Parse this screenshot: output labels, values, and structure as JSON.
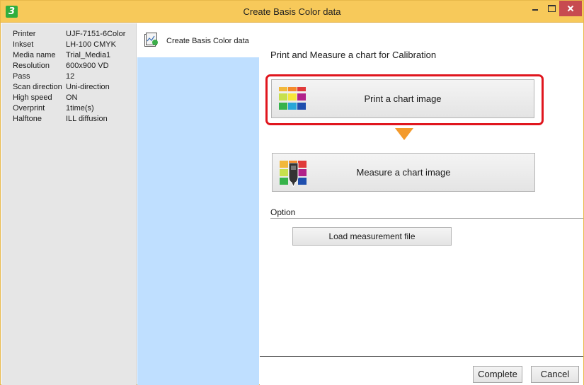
{
  "window": {
    "title": "Create Basis Color data"
  },
  "info": [
    {
      "label": "Printer",
      "value": "UJF-7151-6Color"
    },
    {
      "label": "Inkset",
      "value": "LH-100 CMYK"
    },
    {
      "label": "Media name",
      "value": "Trial_Media1"
    },
    {
      "label": "Resolution",
      "value": "600x900 VD"
    },
    {
      "label": "Pass",
      "value": "12"
    },
    {
      "label": "Scan direction",
      "value": "Uni-direction"
    },
    {
      "label": "High speed",
      "value": "ON"
    },
    {
      "label": "Overprint",
      "value": "1time(s)"
    },
    {
      "label": "Halftone",
      "value": "ILL diffusion"
    }
  ],
  "steps": {
    "items": [
      {
        "label": "Create Basis Color data",
        "icon": "chart-document-icon"
      }
    ]
  },
  "main": {
    "heading": "Print and Measure a chart for Calibration",
    "print_button": {
      "label": "Print a chart image",
      "icon": "color-chart-print-icon"
    },
    "measure_button": {
      "label": "Measure a chart image",
      "icon": "color-chart-measure-icon"
    },
    "option_label": "Option",
    "load_button": "Load measurement file"
  },
  "footer": {
    "complete": "Complete",
    "cancel": "Cancel"
  },
  "colors": {
    "titlebar": "#f7c95a",
    "steps_bg": "#bfdfff",
    "highlight": "#e0161e",
    "arrow": "#f39a2c",
    "close": "#c74b50"
  }
}
